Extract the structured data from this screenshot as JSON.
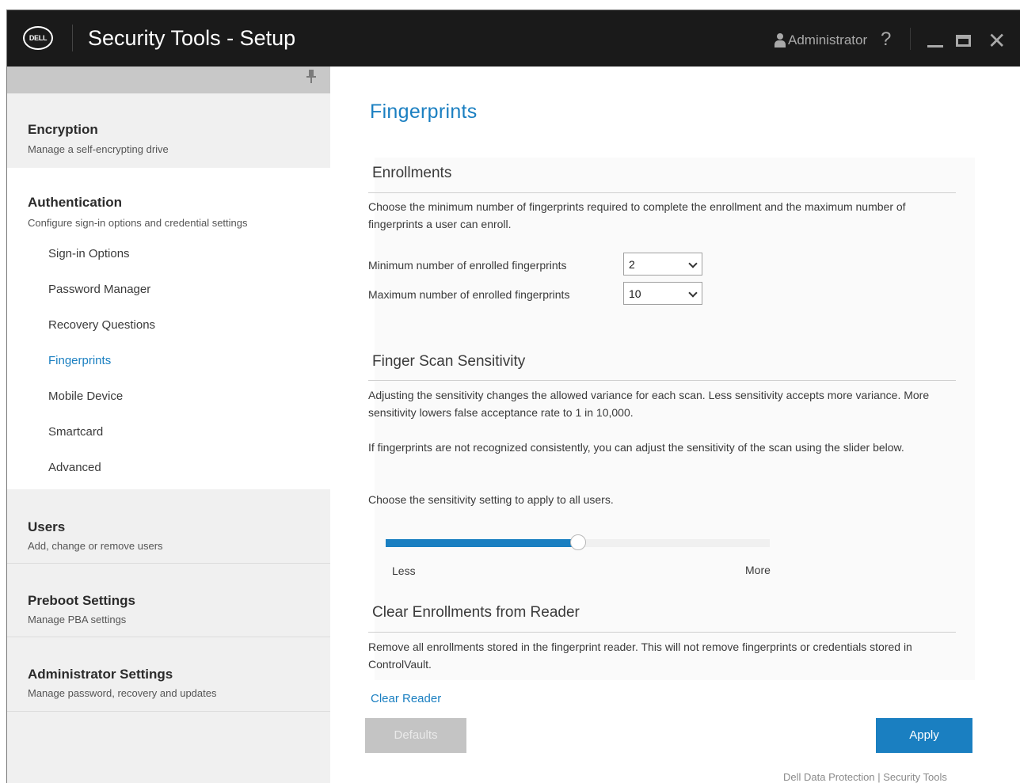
{
  "window": {
    "logo_text": "DELL",
    "title": "Security Tools - Setup",
    "user": "Administrator",
    "help": "?",
    "close": "✕"
  },
  "sidebar": {
    "sections": {
      "encryption": {
        "title": "Encryption",
        "subtitle": "Manage a self-encrypting drive"
      },
      "authentication": {
        "title": "Authentication",
        "subtitle": "Configure sign-in options and credential settings",
        "items": [
          "Sign-in Options",
          "Password Manager",
          "Recovery Questions",
          "Fingerprints",
          "Mobile Device",
          "Smartcard",
          "Advanced"
        ],
        "active": "Fingerprints"
      },
      "users": {
        "title": "Users",
        "subtitle": "Add, change or remove users"
      },
      "preboot": {
        "title": "Preboot Settings",
        "subtitle": "Manage PBA settings"
      },
      "admin": {
        "title": "Administrator Settings",
        "subtitle": "Manage password, recovery and updates"
      }
    }
  },
  "main": {
    "title": "Fingerprints",
    "enrollments": {
      "title": "Enrollments",
      "description": "Choose the minimum number of fingerprints required to complete the enrollment and the maximum number of fingerprints a user can enroll.",
      "min_label": "Minimum number of enrolled fingerprints",
      "min_value": "2",
      "max_label": "Maximum number of enrolled fingerprints",
      "max_value": "10"
    },
    "sensitivity": {
      "title": "Finger Scan Sensitivity",
      "description1": "Adjusting the sensitivity changes the allowed variance for each scan. Less sensitivity accepts more variance. More sensitivity lowers false acceptance rate to 1 in 10,000.",
      "description2": "If fingerprints are not recognized consistently, you can adjust the sensitivity of the scan using the slider below.",
      "prompt": "Choose the sensitivity setting to apply to all users.",
      "slider_value": 0.5,
      "less_label": "Less",
      "more_label": "More"
    },
    "clear": {
      "title": "Clear Enrollments from Reader",
      "description": "Remove all enrollments stored in the fingerprint reader. This will not remove fingerprints or credentials stored in ControlVault.",
      "link": "Clear Reader"
    },
    "buttons": {
      "defaults": "Defaults",
      "apply": "Apply"
    },
    "footer": "Dell Data Protection | Security Tools"
  },
  "colors": {
    "accent": "#1a7fc1",
    "titlebar": "#1a1a1a",
    "sidebar": "#f0f0f0"
  }
}
